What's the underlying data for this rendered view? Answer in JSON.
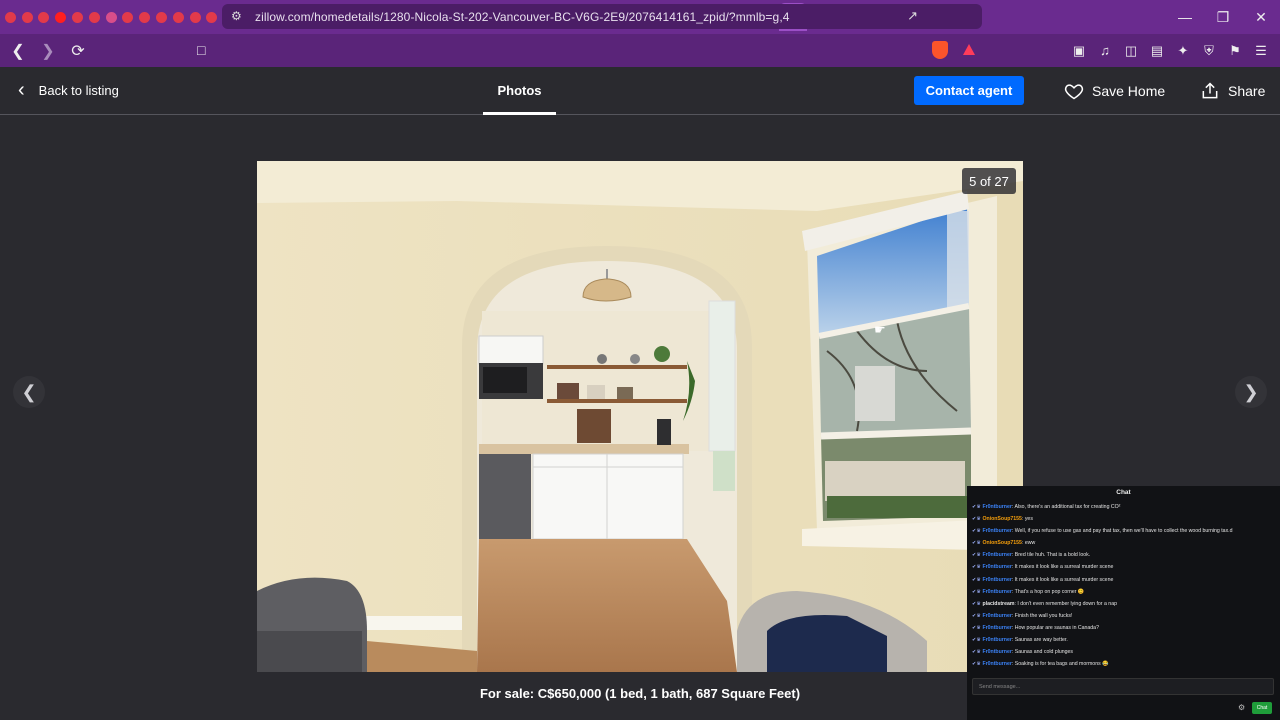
{
  "browser": {
    "url": "zillow.com/homedetails/1280-Nicola-St-202-Vancouver-BC-V6G-2E9/2076414161_zpid/?mmlb=g,4",
    "tab_count_icons": 47,
    "accent": "#6a2b8f",
    "brave_badge": "17"
  },
  "header": {
    "back_label": "Back to listing",
    "tab_label": "Photos",
    "contact_label": "Contact agent",
    "save_label": "Save Home",
    "share_label": "Share",
    "contact_color": "#006aff"
  },
  "gallery": {
    "counter": "5 of 27",
    "caption": "For sale: C$650,000 (1 bed, 1 bath, 687 Square Feet)"
  },
  "chat": {
    "title": "Chat",
    "placeholder": "Send message...",
    "send_label": "Chat",
    "messages": [
      {
        "user": "Fr0ntburner",
        "color": "u1",
        "text": ": Also, there's an additional tax for creating CO²"
      },
      {
        "user": "OnionSoup7155",
        "color": "u2",
        "text": ": yes"
      },
      {
        "user": "Fr0ntburner",
        "color": "u1",
        "text": ": Well, if you refuse to use gas and pay that tax, then we'll have to collect the wood burning tax.d"
      },
      {
        "user": "OnionSoup7155",
        "color": "u2",
        "text": ": eww"
      },
      {
        "user": "Fr0ntburner",
        "color": "u1",
        "text": ": Bred tile huh. That is a bold look."
      },
      {
        "user": "Fr0ntburner",
        "color": "u1",
        "text": ": It makes it look like a surreal murder scene"
      },
      {
        "user": "Fr0ntburner",
        "color": "u1",
        "text": ": It makes it look like a surreal murder scene"
      },
      {
        "user": "Fr0ntburner",
        "color": "u1",
        "text": ": That's a hop on pop corner 😊"
      },
      {
        "user": "placidstream",
        "color": "u3",
        "text": ": I don't even remember lying down for a nap"
      },
      {
        "user": "Fr0ntburner",
        "color": "u1",
        "text": ": Finish the wall you fucks!"
      },
      {
        "user": "Fr0ntburner",
        "color": "u1",
        "text": ": How popular are saunas in Canada?"
      },
      {
        "user": "Fr0ntburner",
        "color": "u1",
        "text": ": Saunas are way better."
      },
      {
        "user": "Fr0ntburner",
        "color": "u1",
        "text": ": Saunas and cold plunges"
      },
      {
        "user": "Fr0ntburner",
        "color": "u1",
        "text": ": Soaking is for tea bags and mormons 😂"
      }
    ]
  }
}
